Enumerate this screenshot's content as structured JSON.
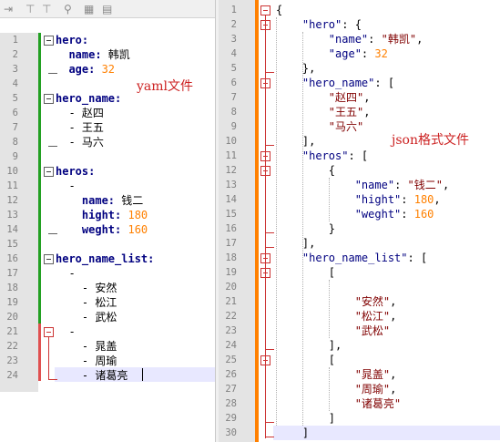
{
  "colors": {
    "yaml_key": "#000080",
    "number": "#ff8000",
    "json_key": "#000080",
    "json_string": "#800000",
    "annotation": "#cc2222",
    "change_bar_saved": "#22a022",
    "change_bar_modified": "#ff8000",
    "gutter": "#e4e4e4",
    "current_line": "#e8e8ff"
  },
  "toolbar": {
    "icons": [
      "indent-icon",
      "fold-icon",
      "marker-icon",
      "grid-icon",
      "document-icon"
    ]
  },
  "left_editor": {
    "annotation": "yaml文件",
    "lines": [
      [
        {
          "t": "hero:",
          "c": "ykey"
        }
      ],
      [
        {
          "t": "  name: ",
          "c": "ykey"
        },
        {
          "t": "韩凯",
          "c": "yval"
        }
      ],
      [
        {
          "t": "  age: ",
          "c": "ykey"
        },
        {
          "t": "32",
          "c": "ynum"
        }
      ],
      [],
      [
        {
          "t": "hero_name:",
          "c": "ykey"
        }
      ],
      [
        {
          "t": "  - 赵四",
          "c": "yval"
        }
      ],
      [
        {
          "t": "  - 王五",
          "c": "yval"
        }
      ],
      [
        {
          "t": "  - 马六",
          "c": "yval"
        }
      ],
      [],
      [
        {
          "t": "heros:",
          "c": "ykey"
        }
      ],
      [
        {
          "t": "  -",
          "c": "yval"
        }
      ],
      [
        {
          "t": "    name: ",
          "c": "ykey"
        },
        {
          "t": "钱二",
          "c": "yval"
        }
      ],
      [
        {
          "t": "    hight: ",
          "c": "ykey"
        },
        {
          "t": "180",
          "c": "ynum"
        }
      ],
      [
        {
          "t": "    weght: ",
          "c": "ykey"
        },
        {
          "t": "160",
          "c": "ynum"
        }
      ],
      [],
      [
        {
          "t": "hero_name_list:",
          "c": "ykey"
        }
      ],
      [
        {
          "t": "  -",
          "c": "yval"
        }
      ],
      [
        {
          "t": "    - 安然",
          "c": "yval"
        }
      ],
      [
        {
          "t": "    - 松江",
          "c": "yval"
        }
      ],
      [
        {
          "t": "    - 武松",
          "c": "yval"
        }
      ],
      [
        {
          "t": "  -",
          "c": "yval"
        }
      ],
      [
        {
          "t": "    - 晁盖",
          "c": "yval"
        }
      ],
      [
        {
          "t": "    - 周瑜",
          "c": "yval"
        }
      ],
      [
        {
          "t": "    - 诸葛亮",
          "c": "yval"
        }
      ]
    ]
  },
  "right_editor": {
    "annotation": "json格式文件",
    "lines": [
      [
        {
          "t": "{",
          "c": "jp"
        }
      ],
      [
        {
          "t": "    ",
          "c": "jp"
        },
        {
          "t": "\"hero\"",
          "c": "jkey"
        },
        {
          "t": ": {",
          "c": "jp"
        }
      ],
      [
        {
          "t": "        ",
          "c": "jp"
        },
        {
          "t": "\"name\"",
          "c": "jkey"
        },
        {
          "t": ": ",
          "c": "jp"
        },
        {
          "t": "\"韩凯\"",
          "c": "js"
        },
        {
          "t": ",",
          "c": "jp"
        }
      ],
      [
        {
          "t": "        ",
          "c": "jp"
        },
        {
          "t": "\"age\"",
          "c": "jkey"
        },
        {
          "t": ": ",
          "c": "jp"
        },
        {
          "t": "32",
          "c": "jn"
        }
      ],
      [
        {
          "t": "    },",
          "c": "jp"
        }
      ],
      [
        {
          "t": "    ",
          "c": "jp"
        },
        {
          "t": "\"hero_name\"",
          "c": "jkey"
        },
        {
          "t": ": [",
          "c": "jp"
        }
      ],
      [
        {
          "t": "        ",
          "c": "jp"
        },
        {
          "t": "\"赵四\"",
          "c": "js"
        },
        {
          "t": ",",
          "c": "jp"
        }
      ],
      [
        {
          "t": "        ",
          "c": "jp"
        },
        {
          "t": "\"王五\"",
          "c": "js"
        },
        {
          "t": ",",
          "c": "jp"
        }
      ],
      [
        {
          "t": "        ",
          "c": "jp"
        },
        {
          "t": "\"马六\"",
          "c": "js"
        }
      ],
      [
        {
          "t": "    ],",
          "c": "jp"
        }
      ],
      [
        {
          "t": "    ",
          "c": "jp"
        },
        {
          "t": "\"heros\"",
          "c": "jkey"
        },
        {
          "t": ": [",
          "c": "jp"
        }
      ],
      [
        {
          "t": "        {",
          "c": "jp"
        }
      ],
      [
        {
          "t": "            ",
          "c": "jp"
        },
        {
          "t": "\"name\"",
          "c": "jkey"
        },
        {
          "t": ": ",
          "c": "jp"
        },
        {
          "t": "\"钱二\"",
          "c": "js"
        },
        {
          "t": ",",
          "c": "jp"
        }
      ],
      [
        {
          "t": "            ",
          "c": "jp"
        },
        {
          "t": "\"hight\"",
          "c": "jkey"
        },
        {
          "t": ": ",
          "c": "jp"
        },
        {
          "t": "180",
          "c": "jn"
        },
        {
          "t": ",",
          "c": "jp"
        }
      ],
      [
        {
          "t": "            ",
          "c": "jp"
        },
        {
          "t": "\"weght\"",
          "c": "jkey"
        },
        {
          "t": ": ",
          "c": "jp"
        },
        {
          "t": "160",
          "c": "jn"
        }
      ],
      [
        {
          "t": "        }",
          "c": "jp"
        }
      ],
      [
        {
          "t": "    ],",
          "c": "jp"
        }
      ],
      [
        {
          "t": "    ",
          "c": "jp"
        },
        {
          "t": "\"hero_name_list\"",
          "c": "jkey"
        },
        {
          "t": ": [",
          "c": "jp"
        }
      ],
      [
        {
          "t": "        [",
          "c": "jp"
        }
      ],
      [],
      [
        {
          "t": "            ",
          "c": "jp"
        },
        {
          "t": "\"安然\"",
          "c": "js"
        },
        {
          "t": ",",
          "c": "jp"
        }
      ],
      [
        {
          "t": "            ",
          "c": "jp"
        },
        {
          "t": "\"松江\"",
          "c": "js"
        },
        {
          "t": ",",
          "c": "jp"
        }
      ],
      [
        {
          "t": "            ",
          "c": "jp"
        },
        {
          "t": "\"武松\"",
          "c": "js"
        }
      ],
      [
        {
          "t": "        ],",
          "c": "jp"
        }
      ],
      [
        {
          "t": "        [",
          "c": "jp"
        }
      ],
      [
        {
          "t": "            ",
          "c": "jp"
        },
        {
          "t": "\"晁盖\"",
          "c": "js"
        },
        {
          "t": ",",
          "c": "jp"
        }
      ],
      [
        {
          "t": "            ",
          "c": "jp"
        },
        {
          "t": "\"周瑜\"",
          "c": "js"
        },
        {
          "t": ",",
          "c": "jp"
        }
      ],
      [
        {
          "t": "            ",
          "c": "jp"
        },
        {
          "t": "\"诸葛亮\"",
          "c": "js"
        }
      ],
      [
        {
          "t": "        ]",
          "c": "jp"
        }
      ],
      [
        {
          "t": "    ]",
          "c": "jp"
        }
      ],
      []
    ]
  }
}
